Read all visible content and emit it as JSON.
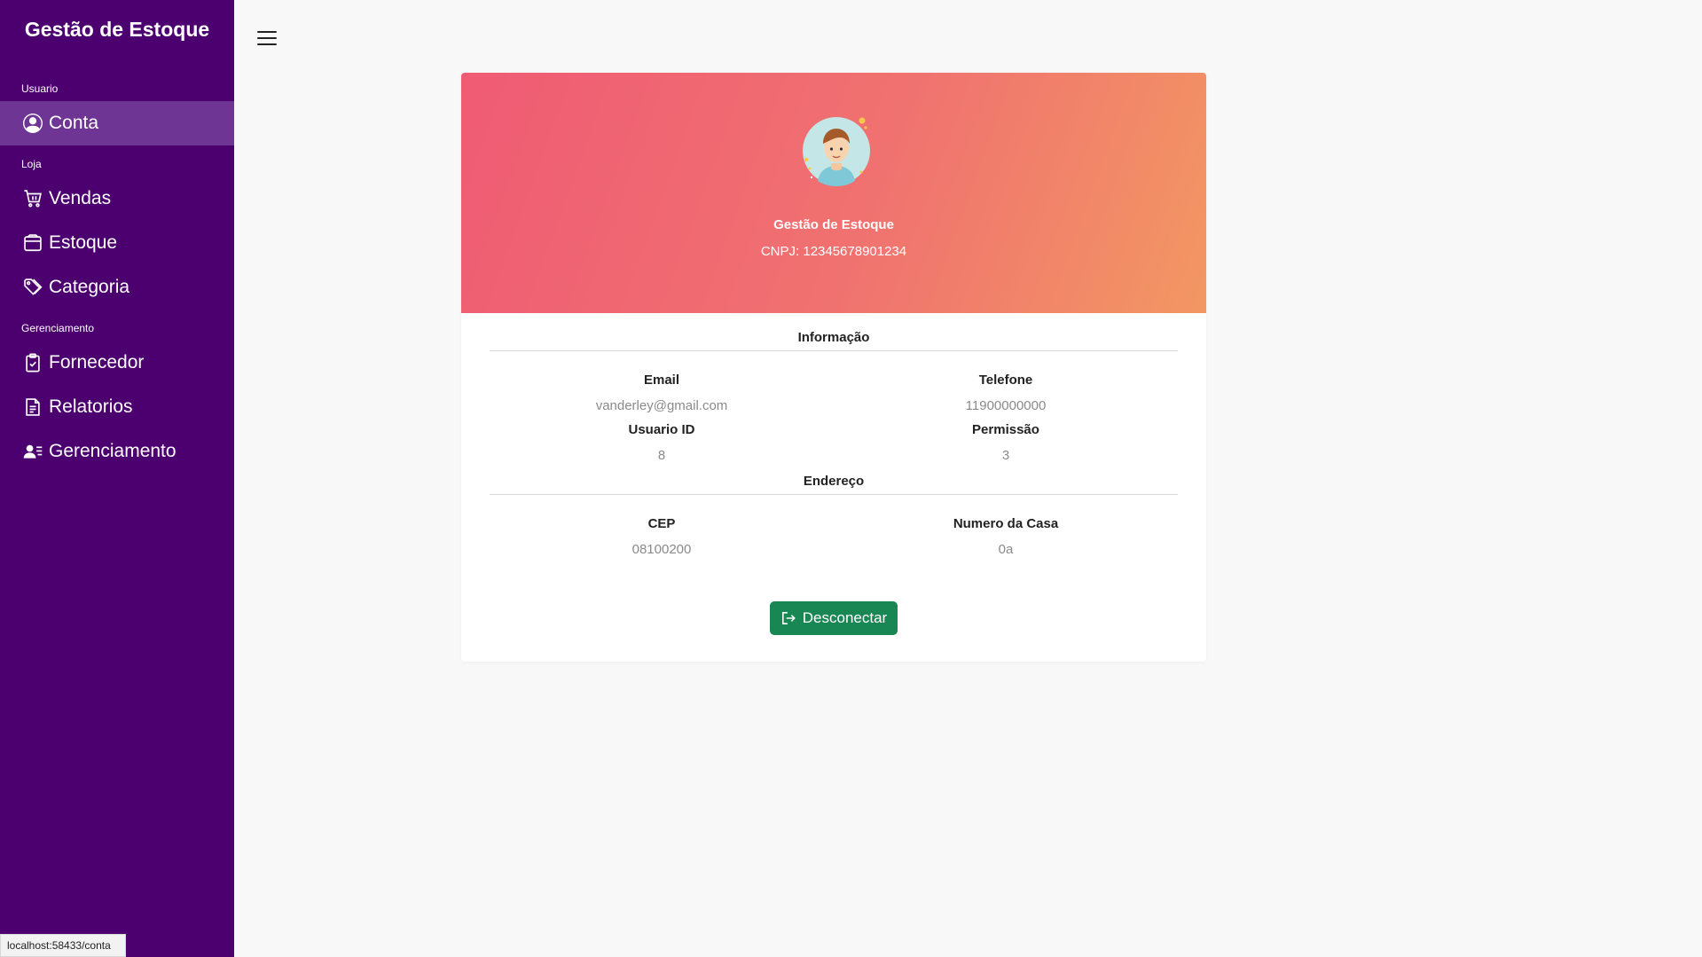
{
  "sidebar": {
    "brand": "Gestão de Estoque",
    "sections": [
      {
        "label": "Usuario",
        "items": [
          {
            "label": "Conta",
            "icon": "user-circle-icon",
            "active": true
          }
        ]
      },
      {
        "label": "Loja",
        "items": [
          {
            "label": "Vendas",
            "icon": "cart-icon"
          },
          {
            "label": "Estoque",
            "icon": "box-icon"
          },
          {
            "label": "Categoria",
            "icon": "tags-icon"
          }
        ]
      },
      {
        "label": "Gerenciamento",
        "items": [
          {
            "label": "Fornecedor",
            "icon": "clipboard-check-icon"
          },
          {
            "label": "Relatorios",
            "icon": "file-text-icon"
          },
          {
            "label": "Gerenciamento",
            "icon": "person-lines-icon"
          }
        ]
      }
    ]
  },
  "profile": {
    "name": "Gestão de Estoque",
    "cnpj": "CNPJ: 12345678901234"
  },
  "info": {
    "title": "Informação",
    "email_label": "Email",
    "email": "vanderley@gmail.com",
    "phone_label": "Telefone",
    "phone": "11900000000",
    "user_id_label": "Usuario ID",
    "user_id": "8",
    "permission_label": "Permissão",
    "permission": "3"
  },
  "address": {
    "title": "Endereço",
    "cep_label": "CEP",
    "cep": "08100200",
    "house_label": "Numero da Casa",
    "house": "0a"
  },
  "logout_label": "Desconectar",
  "status_url": "localhost:58433/conta",
  "colors": {
    "sidebar": "#4c0070",
    "sidebar_active": "#6f3594",
    "header_gradient_start": "#ef5b74",
    "header_gradient_end": "#f29763",
    "button": "#198754"
  }
}
